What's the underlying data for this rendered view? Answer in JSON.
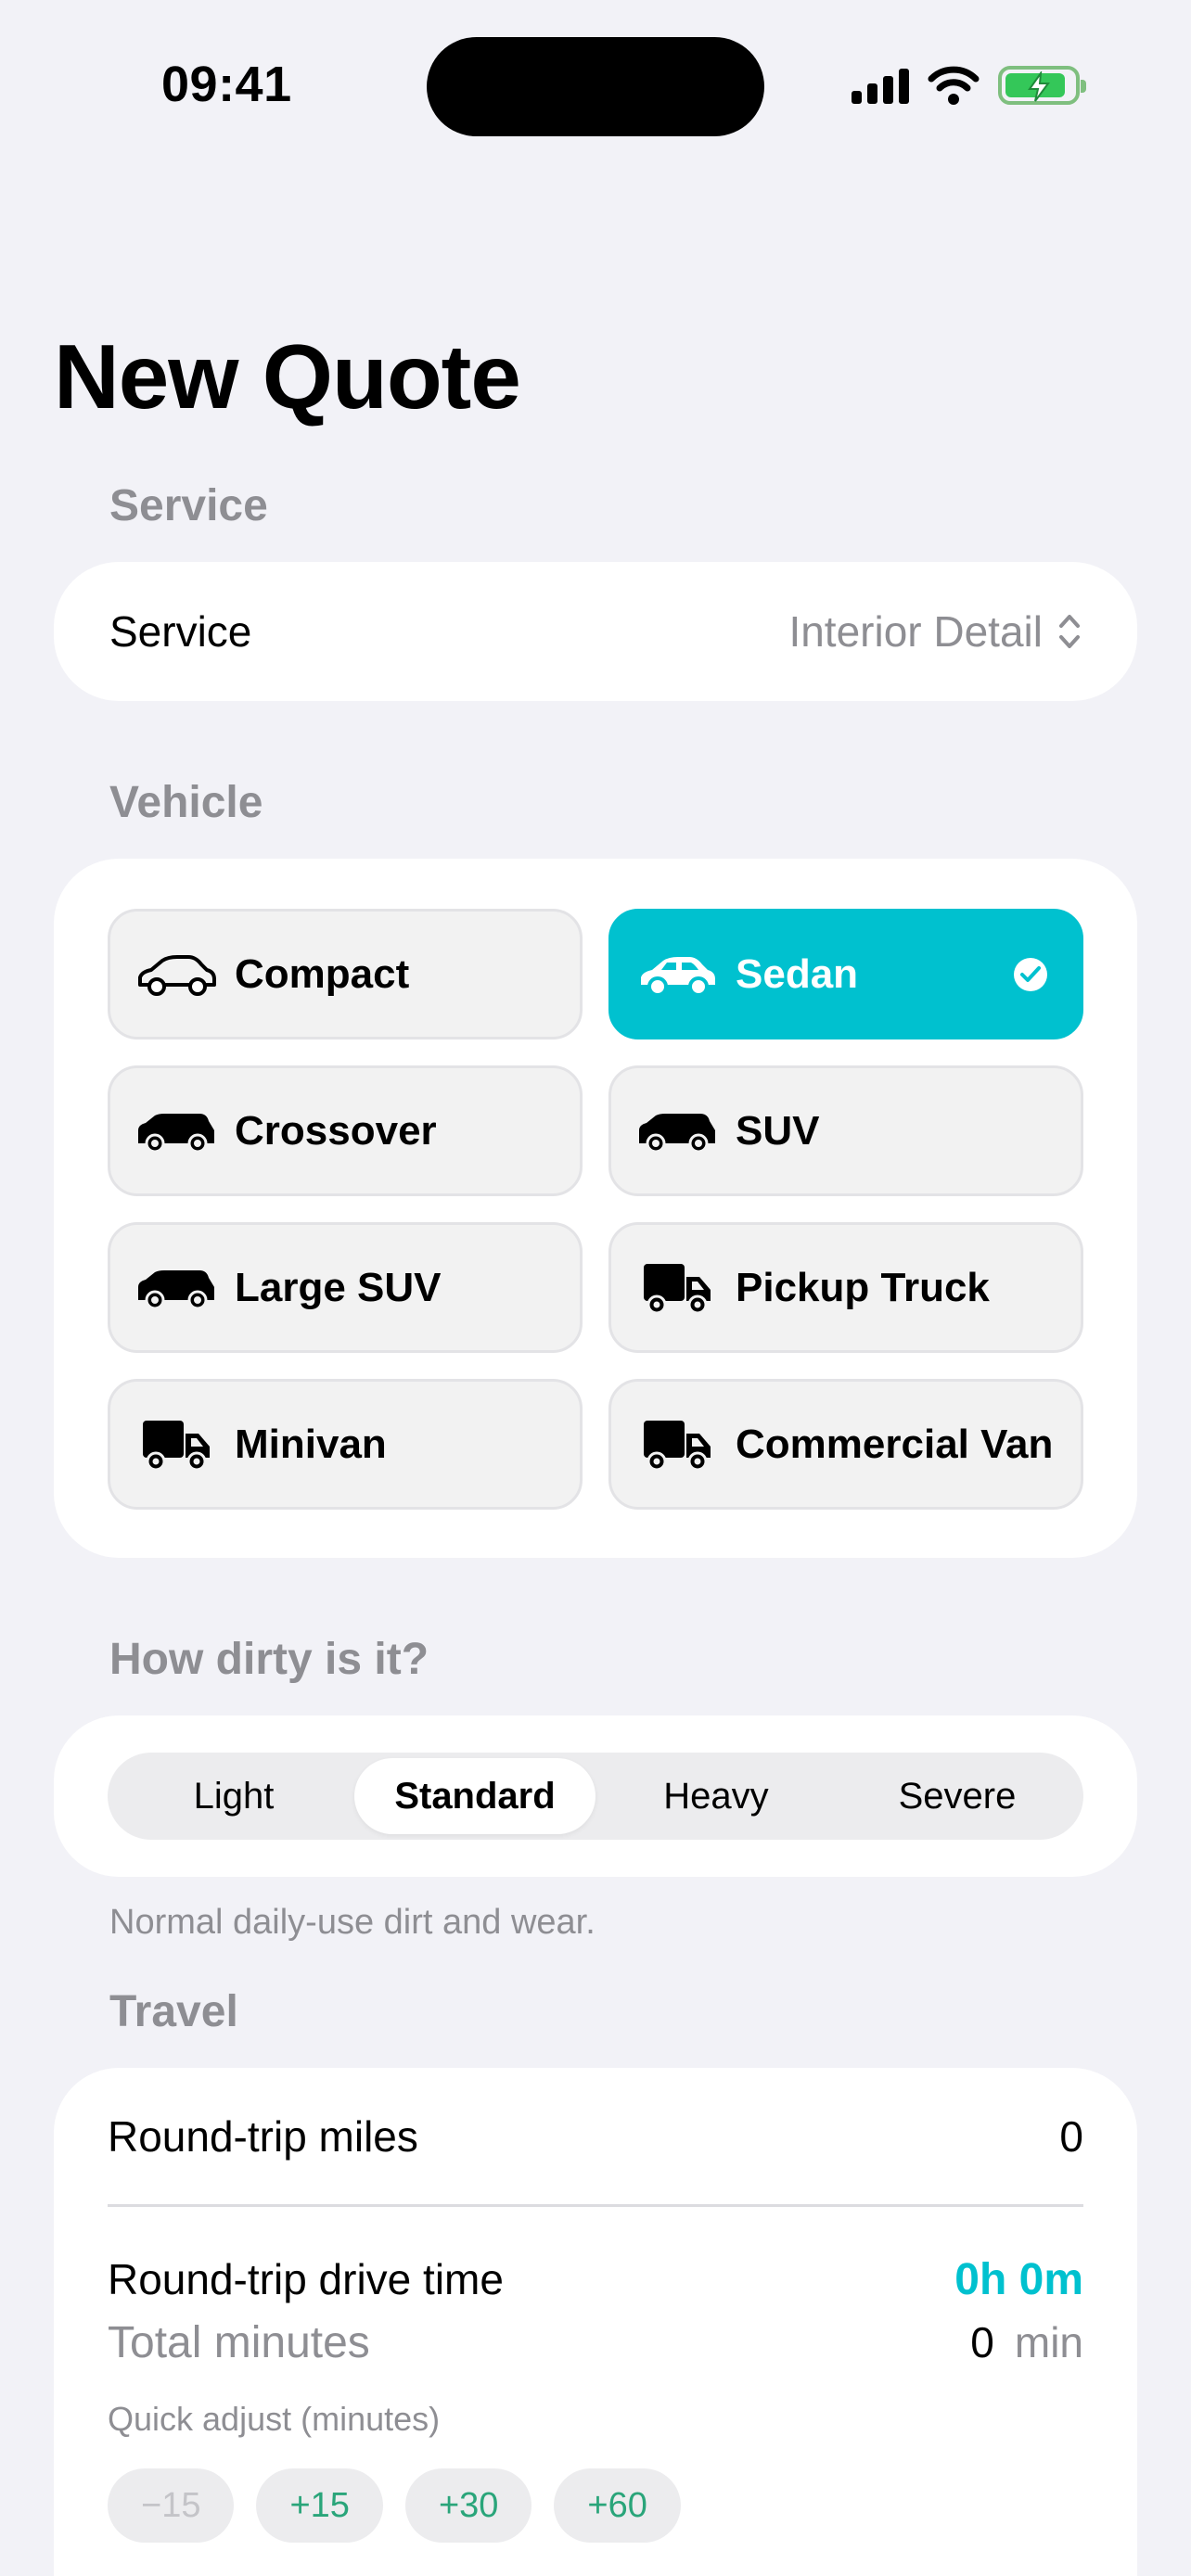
{
  "status_bar": {
    "time": "09:41"
  },
  "page": {
    "title": "New Quote"
  },
  "service_section": {
    "header": "Service",
    "row_label": "Service",
    "selected_value": "Interior Detail"
  },
  "vehicle_section": {
    "header": "Vehicle",
    "options": [
      {
        "label": "Compact",
        "icon": "car-outline-icon",
        "selected": false
      },
      {
        "label": "Sedan",
        "icon": "car-icon",
        "selected": true
      },
      {
        "label": "Crossover",
        "icon": "car-suv-icon",
        "selected": false
      },
      {
        "label": "SUV",
        "icon": "car-suv-icon",
        "selected": false
      },
      {
        "label": "Large SUV",
        "icon": "car-suv-icon",
        "selected": false
      },
      {
        "label": "Pickup Truck",
        "icon": "truck-icon",
        "selected": false
      },
      {
        "label": "Minivan",
        "icon": "truck-icon",
        "selected": false
      },
      {
        "label": "Commercial Van",
        "icon": "truck-icon",
        "selected": false
      }
    ]
  },
  "dirtiness_section": {
    "header": "How dirty is it?",
    "options": [
      "Light",
      "Standard",
      "Heavy",
      "Severe"
    ],
    "selected": "Standard",
    "hint": "Normal daily-use dirt and wear."
  },
  "travel_section": {
    "header": "Travel",
    "miles_label": "Round-trip miles",
    "miles_value": "0",
    "drive_time_label": "Round-trip drive time",
    "drive_time_value": "0h 0m",
    "total_minutes_label": "Total minutes",
    "total_minutes_value": "0",
    "total_minutes_unit": "min",
    "quick_adjust_label": "Quick adjust (minutes)",
    "quick_adjust": [
      "−15",
      "+15",
      "+30",
      "+60"
    ]
  },
  "colors": {
    "accent": "#00c1cf",
    "background": "#f2f2f7",
    "secondary_text": "#8e8e93",
    "chip_text": "#2aa57a",
    "battery": "#34c759"
  }
}
